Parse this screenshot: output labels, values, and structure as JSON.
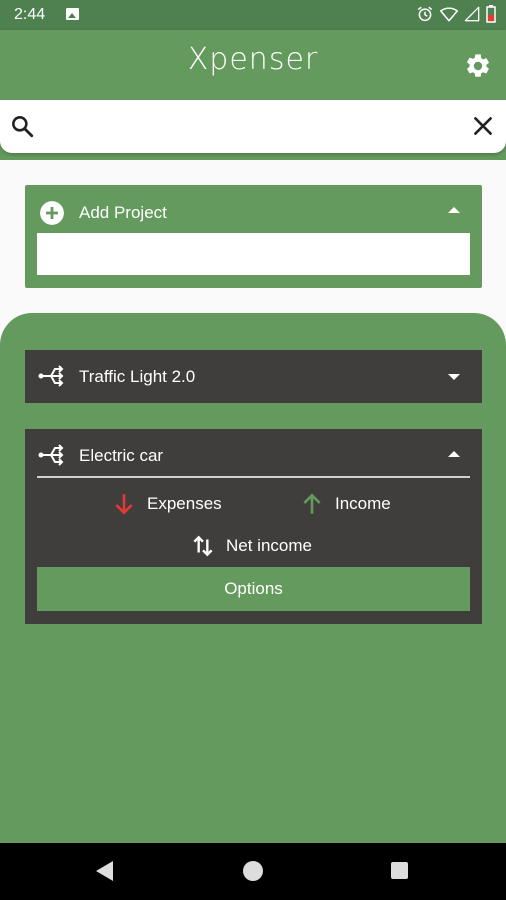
{
  "status_bar": {
    "time": "2:44"
  },
  "app_bar": {
    "title": "Xpenser"
  },
  "search": {
    "value": "",
    "placeholder": ""
  },
  "add_project": {
    "label": "Add Project",
    "input_value": ""
  },
  "projects": [
    {
      "name": "Traffic Light 2.0",
      "expanded": false
    },
    {
      "name": "Electric car",
      "expanded": true,
      "actions": {
        "expenses": "Expenses",
        "income": "Income",
        "net_income": "Net income",
        "options": "Options"
      }
    }
  ],
  "colors": {
    "primary": "#659a5e",
    "status_bar": "#4f8050",
    "card_dark": "#403e3c",
    "expense": "#e53935",
    "income": "#659a5e"
  },
  "icons": {
    "settings": "gear-icon",
    "search": "search-icon",
    "clear": "close-icon",
    "add": "add-circle-icon",
    "project": "fork-arrow-icon",
    "expenses": "arrow-down-icon",
    "income": "arrow-up-icon",
    "net_income": "swap-vert-icon"
  }
}
